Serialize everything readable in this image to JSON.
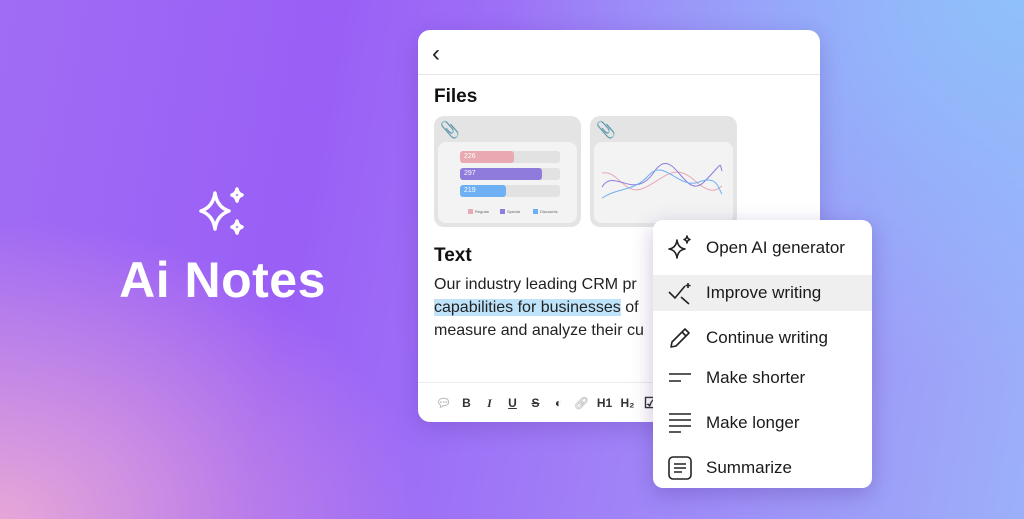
{
  "brand": {
    "title": "Ai Notes",
    "icon": "sparkles-icon"
  },
  "note": {
    "back_icon": "chevron-left-icon",
    "files_heading": "Files",
    "files": [
      {
        "icon": "paperclip-icon",
        "preview": {
          "type": "bar",
          "values": [
            226,
            297,
            219
          ],
          "labels": [
            "226",
            "297",
            "219"
          ],
          "colors": [
            "#e8a9b2",
            "#8f7bdb",
            "#6fb0f4"
          ],
          "legend": [
            "Regular",
            "Special",
            "Discounts"
          ]
        }
      },
      {
        "icon": "paperclip-icon",
        "preview": {
          "type": "line"
        }
      }
    ],
    "text_heading": "Text",
    "paragraph": {
      "line1": "Our industry leading CRM pr",
      "line2_highlighted": "capabilities for businesses",
      "line2_rest": " of",
      "line3": "measure and analyze their cu"
    },
    "toolbar": [
      "comment",
      "B",
      "I",
      "U",
      "S",
      "◐",
      "link",
      "H1",
      "H₂",
      "☑"
    ]
  },
  "menu": {
    "items": [
      {
        "label": "Open AI generator",
        "icon": "sparkles-icon"
      },
      {
        "label": "Improve writing",
        "icon": "check-sparkle-icon",
        "active": true
      },
      {
        "label": "Continue writing",
        "icon": "pencil-icon"
      },
      {
        "label": "Make shorter",
        "icon": "short-lines-icon"
      },
      {
        "label": "Make longer",
        "icon": "long-lines-icon"
      },
      {
        "label": "Summarize",
        "icon": "summary-doc-icon"
      }
    ]
  }
}
